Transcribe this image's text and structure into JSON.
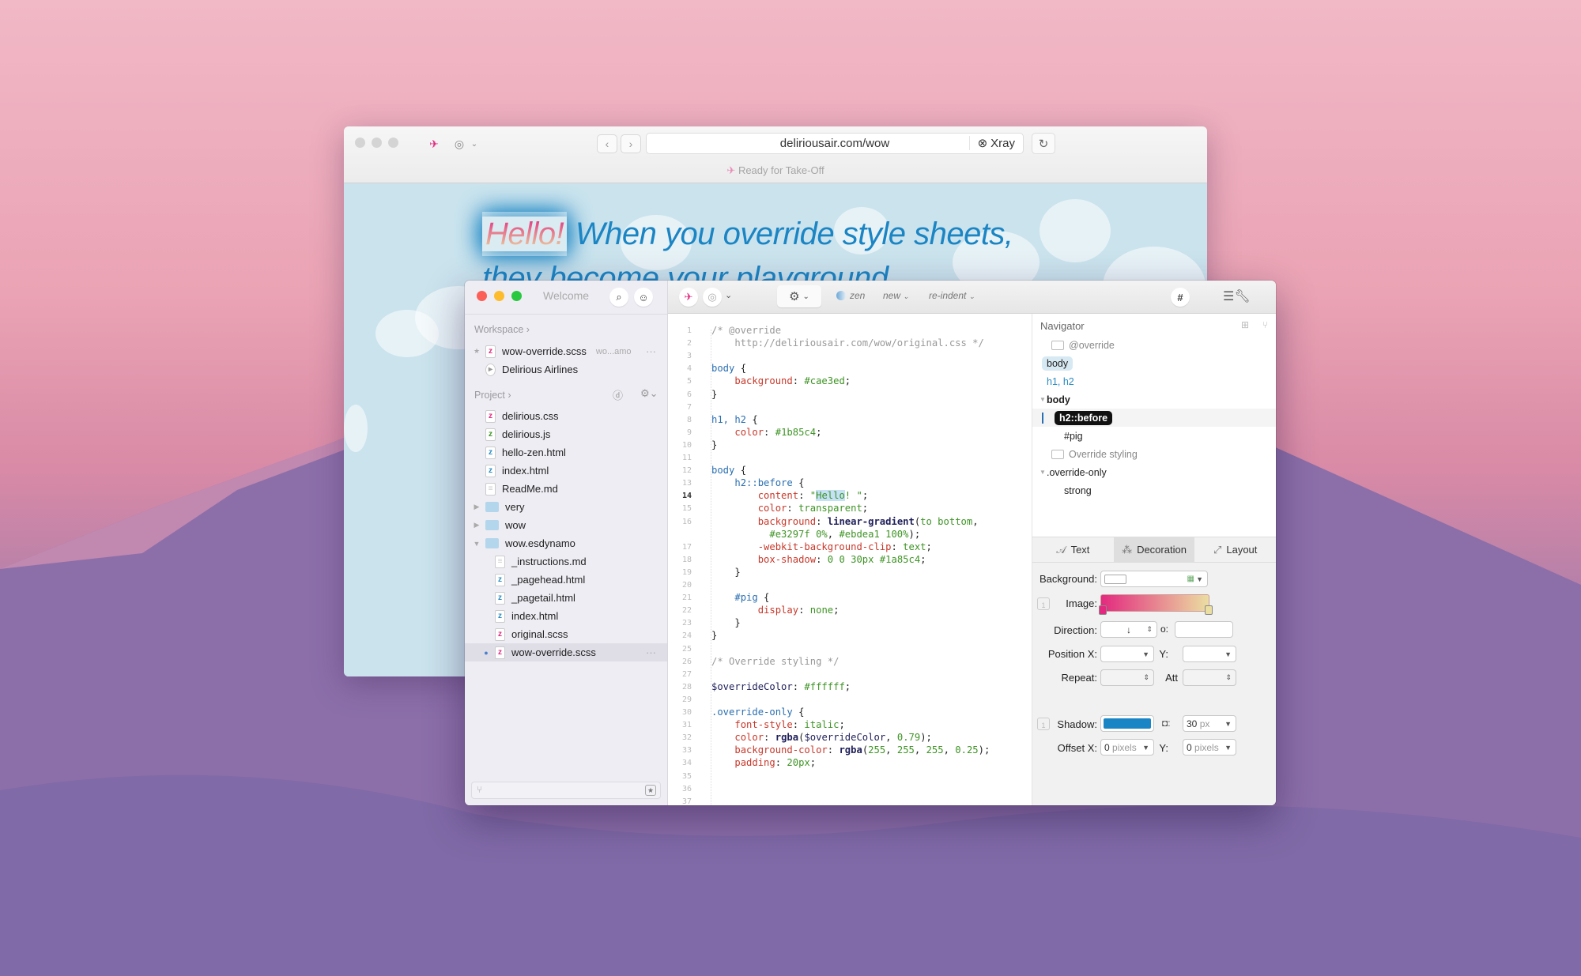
{
  "browser": {
    "url": "deliriousair.com/wow",
    "xray_label": "Xray",
    "status": "Ready for Take-Off",
    "headline_hello": "Hello!",
    "headline_line1": " When you override style sheets,",
    "headline_line2": "they become your playground."
  },
  "editor": {
    "welcome": "Welcome",
    "toolbar": {
      "zen_label": "zen",
      "new_label": "new",
      "reindent_label": "re-indent",
      "hash_label": "#"
    },
    "sidebar": {
      "workspace_label": "Workspace",
      "workspace_items": [
        {
          "name": "wow-override.scss",
          "detail": "wo...amo",
          "type": "scss"
        },
        {
          "name": "Delirious Airlines",
          "type": "site"
        }
      ],
      "project_label": "Project",
      "project_items": [
        {
          "name": "delirious.css",
          "type": "css",
          "depth": 0
        },
        {
          "name": "delirious.js",
          "type": "js",
          "depth": 0
        },
        {
          "name": "hello-zen.html",
          "type": "html",
          "depth": 0
        },
        {
          "name": "index.html",
          "type": "html",
          "depth": 0
        },
        {
          "name": "ReadMe.md",
          "type": "md",
          "depth": 0
        },
        {
          "name": "very",
          "type": "folder",
          "depth": 0,
          "expanded": false
        },
        {
          "name": "wow",
          "type": "folder",
          "depth": 0,
          "expanded": false
        },
        {
          "name": "wow.esdynamo",
          "type": "folder",
          "depth": 0,
          "expanded": true
        },
        {
          "name": "_instructions.md",
          "type": "md",
          "depth": 1
        },
        {
          "name": "_pagehead.html",
          "type": "html",
          "depth": 1
        },
        {
          "name": "_pagetail.html",
          "type": "html",
          "depth": 1
        },
        {
          "name": "index.html",
          "type": "html",
          "depth": 1
        },
        {
          "name": "original.scss",
          "type": "scss",
          "depth": 1
        },
        {
          "name": "wow-override.scss",
          "type": "scss",
          "depth": 1,
          "selected": true
        }
      ]
    },
    "code": {
      "current_line": "14",
      "lines": [
        {
          "n": "1",
          "parts": [
            [
              "cm",
              "/* @override"
            ]
          ]
        },
        {
          "n": "2",
          "parts": [
            [
              "cm",
              "    http://deliriousair.com/wow/original.css */"
            ]
          ]
        },
        {
          "n": "3",
          "parts": []
        },
        {
          "n": "4",
          "parts": [
            [
              "sel",
              "body"
            ],
            [
              "",
              " {"
            ]
          ]
        },
        {
          "n": "5",
          "parts": [
            [
              "",
              "    "
            ],
            [
              "prop",
              "background"
            ],
            [
              "",
              ": "
            ],
            [
              "val",
              "#cae3ed"
            ],
            [
              "",
              ";"
            ]
          ]
        },
        {
          "n": "6",
          "parts": [
            [
              "",
              "}"
            ]
          ]
        },
        {
          "n": "7",
          "parts": []
        },
        {
          "n": "8",
          "parts": [
            [
              "sel",
              "h1, h2"
            ],
            [
              "",
              " {"
            ]
          ]
        },
        {
          "n": "9",
          "parts": [
            [
              "",
              "    "
            ],
            [
              "prop",
              "color"
            ],
            [
              "",
              ": "
            ],
            [
              "val",
              "#1b85c4"
            ],
            [
              "",
              ";"
            ]
          ]
        },
        {
          "n": "10",
          "parts": [
            [
              "",
              "}"
            ]
          ]
        },
        {
          "n": "11",
          "parts": []
        },
        {
          "n": "12",
          "parts": [
            [
              "sel",
              "body"
            ],
            [
              "",
              " {"
            ]
          ]
        },
        {
          "n": "13",
          "parts": [
            [
              "",
              "    "
            ],
            [
              "sel",
              "h2::before"
            ],
            [
              "",
              " {"
            ]
          ]
        },
        {
          "n": "14",
          "parts": [
            [
              "",
              "        "
            ],
            [
              "prop",
              "content"
            ],
            [
              "",
              ": "
            ],
            [
              "val",
              "\""
            ],
            [
              "hl",
              "Hello"
            ],
            [
              "val",
              "! \""
            ],
            [
              "",
              ";"
            ]
          ]
        },
        {
          "n": "15",
          "parts": [
            [
              "",
              "        "
            ],
            [
              "prop",
              "color"
            ],
            [
              "",
              ": "
            ],
            [
              "val",
              "transparent"
            ],
            [
              "",
              ";"
            ]
          ]
        },
        {
          "n": "16",
          "parts": [
            [
              "",
              "        "
            ],
            [
              "prop",
              "background"
            ],
            [
              "",
              ": "
            ],
            [
              "fn",
              "linear-gradient"
            ],
            [
              "",
              "("
            ],
            [
              "val",
              "to bottom"
            ],
            [
              "",
              ","
            ]
          ]
        },
        {
          "n": "",
          "parts": [
            [
              "",
              "          "
            ],
            [
              "val",
              "#e3297f 0%"
            ],
            [
              "",
              ", "
            ],
            [
              "val",
              "#ebdea1 100%"
            ],
            [
              "",
              ");"
            ]
          ]
        },
        {
          "n": "17",
          "parts": [
            [
              "",
              "        "
            ],
            [
              "prop",
              "-webkit-background-clip"
            ],
            [
              "",
              ": "
            ],
            [
              "val",
              "text"
            ],
            [
              "",
              ";"
            ]
          ]
        },
        {
          "n": "18",
          "parts": [
            [
              "",
              "        "
            ],
            [
              "prop",
              "box-shadow"
            ],
            [
              "",
              ": "
            ],
            [
              "val",
              "0 0 30px #1a85c4"
            ],
            [
              "",
              ";"
            ]
          ]
        },
        {
          "n": "19",
          "parts": [
            [
              "",
              "    }"
            ]
          ]
        },
        {
          "n": "20",
          "parts": []
        },
        {
          "n": "21",
          "parts": [
            [
              "",
              "    "
            ],
            [
              "sel",
              "#pig"
            ],
            [
              "",
              " {"
            ]
          ]
        },
        {
          "n": "22",
          "parts": [
            [
              "",
              "        "
            ],
            [
              "prop",
              "display"
            ],
            [
              "",
              ": "
            ],
            [
              "val",
              "none"
            ],
            [
              "",
              ";"
            ]
          ]
        },
        {
          "n": "23",
          "parts": [
            [
              "",
              "    }"
            ]
          ]
        },
        {
          "n": "24",
          "parts": [
            [
              "",
              "}"
            ]
          ]
        },
        {
          "n": "25",
          "parts": []
        },
        {
          "n": "26",
          "parts": [
            [
              "cm",
              "/* Override styling */"
            ]
          ]
        },
        {
          "n": "27",
          "parts": []
        },
        {
          "n": "28",
          "parts": [
            [
              "var",
              "$overrideColor"
            ],
            [
              "",
              ": "
            ],
            [
              "val",
              "#ffffff"
            ],
            [
              "",
              ";"
            ]
          ]
        },
        {
          "n": "29",
          "parts": []
        },
        {
          "n": "30",
          "parts": [
            [
              "sel",
              ".override-only"
            ],
            [
              "",
              " {"
            ]
          ]
        },
        {
          "n": "31",
          "parts": [
            [
              "",
              "    "
            ],
            [
              "prop",
              "font-style"
            ],
            [
              "",
              ": "
            ],
            [
              "val",
              "italic"
            ],
            [
              "",
              ";"
            ]
          ]
        },
        {
          "n": "32",
          "parts": [
            [
              "",
              "    "
            ],
            [
              "prop",
              "color"
            ],
            [
              "",
              ": "
            ],
            [
              "fn",
              "rgba"
            ],
            [
              "",
              "("
            ],
            [
              "var",
              "$overrideColor"
            ],
            [
              "",
              ", "
            ],
            [
              "val",
              "0.79"
            ],
            [
              "",
              ");"
            ]
          ]
        },
        {
          "n": "33",
          "parts": [
            [
              "",
              "    "
            ],
            [
              "prop",
              "background-color"
            ],
            [
              "",
              ": "
            ],
            [
              "fn",
              "rgba"
            ],
            [
              "",
              "("
            ],
            [
              "val",
              "255"
            ],
            [
              "",
              ", "
            ],
            [
              "val",
              "255"
            ],
            [
              "",
              ", "
            ],
            [
              "val",
              "255"
            ],
            [
              "",
              ", "
            ],
            [
              "val",
              "0.25"
            ],
            [
              "",
              ");"
            ]
          ]
        },
        {
          "n": "34",
          "parts": [
            [
              "",
              "    "
            ],
            [
              "prop",
              "padding"
            ],
            [
              "",
              ": "
            ],
            [
              "val",
              "20px"
            ],
            [
              "",
              ";"
            ]
          ]
        },
        {
          "n": "35",
          "parts": []
        },
        {
          "n": "36",
          "parts": []
        },
        {
          "n": "37",
          "parts": []
        }
      ]
    },
    "navigator": {
      "title": "Navigator",
      "items": [
        {
          "label": "@override",
          "kind": "comment",
          "depth": 0
        },
        {
          "label": "body",
          "kind": "rule-highlight",
          "depth": 0
        },
        {
          "label": "h1, h2",
          "kind": "rule-blue",
          "depth": 0
        },
        {
          "label": "body",
          "kind": "group",
          "depth": 0
        },
        {
          "label": "h2::before",
          "kind": "current",
          "depth": 1
        },
        {
          "label": "#pig",
          "kind": "rule",
          "depth": 1
        },
        {
          "label": "Override styling",
          "kind": "comment",
          "depth": 0
        },
        {
          "label": ".override-only",
          "kind": "group",
          "depth": 0
        },
        {
          "label": "strong",
          "kind": "rule",
          "depth": 1
        }
      ]
    },
    "inspector": {
      "tabs": [
        {
          "label": "Text",
          "active": false
        },
        {
          "label": "Decoration",
          "active": true
        },
        {
          "label": "Layout",
          "active": false
        }
      ],
      "background_label": "Background:",
      "image_label": "Image:",
      "gradient_start": "#e3297f",
      "gradient_end": "#ebdea1",
      "direction_label": "Direction:",
      "direction_value": "↓",
      "degree_symbol": "o:",
      "position_x_label": "Position X:",
      "position_y_label": "Y:",
      "repeat_label": "Repeat:",
      "attachment_label": "Att",
      "shadow_label": "Shadow:",
      "shadow_color": "#1a85c4",
      "blur_value": "30",
      "blur_unit": "px",
      "offset_x_label": "Offset X:",
      "offset_x_value": "0",
      "offset_unit": "pixels",
      "offset_y_label": "Y:",
      "offset_y_value": "0",
      "layer_count": "1"
    }
  }
}
